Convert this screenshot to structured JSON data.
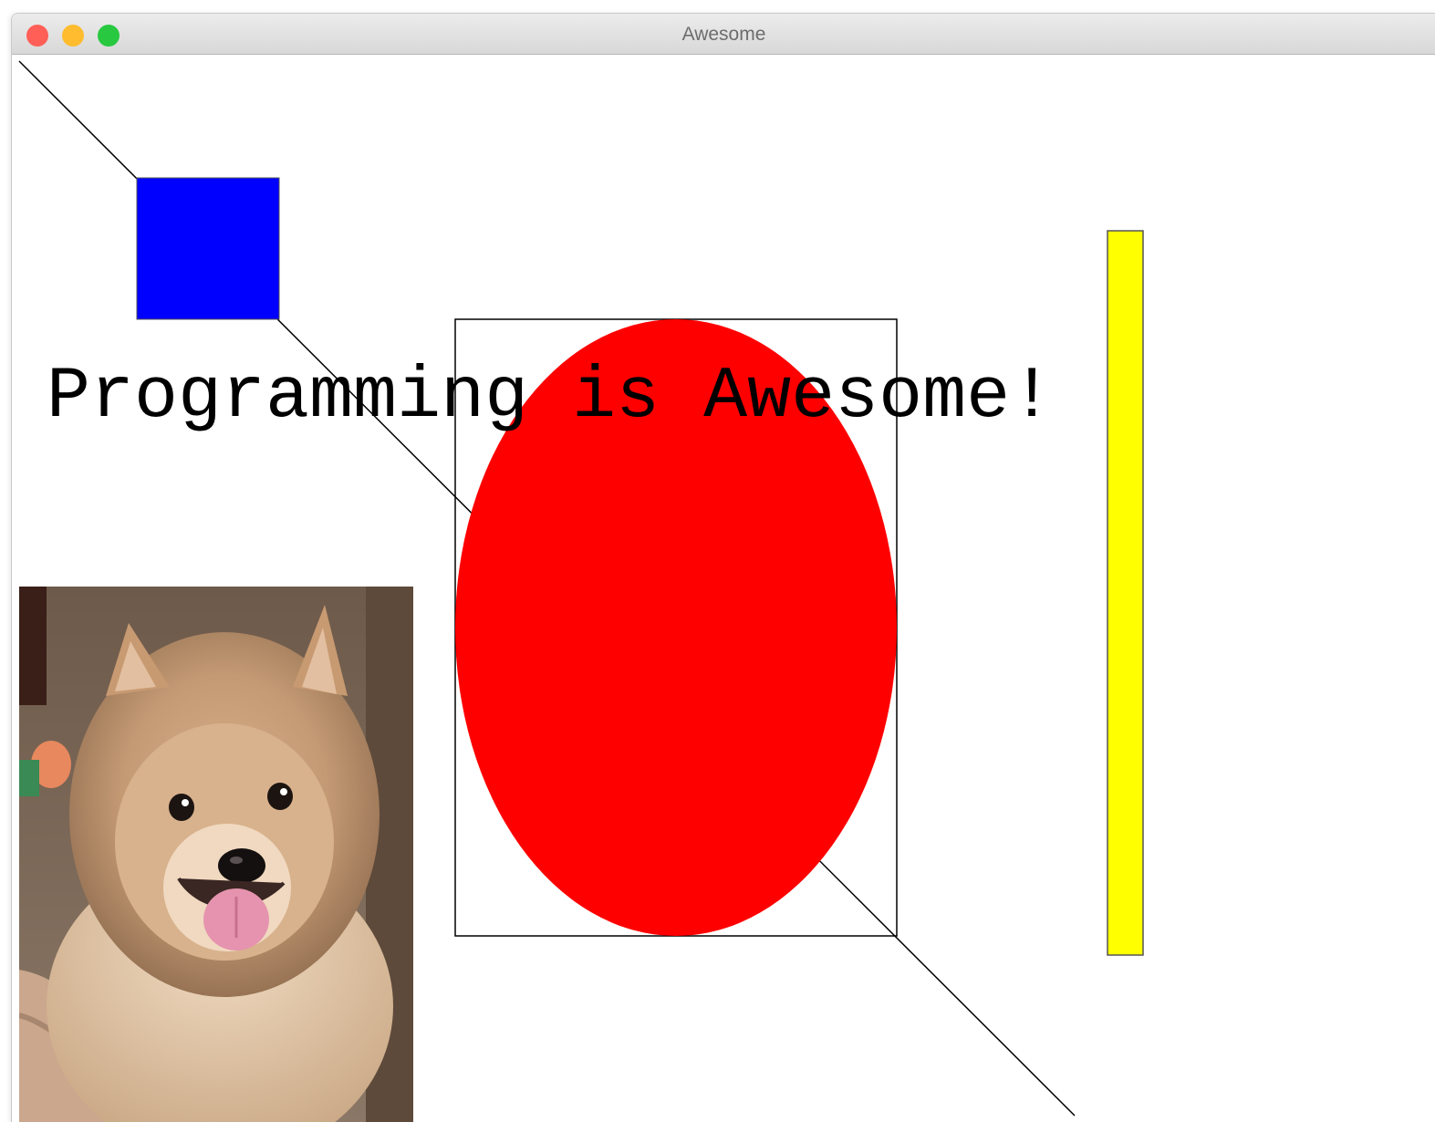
{
  "window": {
    "title": "Awesome",
    "controls": {
      "close_color": "#ff5f57",
      "minimize_color": "#febc2e",
      "zoom_color": "#28c840"
    }
  },
  "canvas": {
    "text": "Programming is Awesome!",
    "shapes": {
      "square_color": "#0000ff",
      "oval_color": "#ff0000",
      "bar_color": "#ffff00",
      "line_color": "#000000",
      "rect_outline_color": "#000000"
    },
    "image": {
      "subject": "pomeranian-dog-photo"
    }
  }
}
